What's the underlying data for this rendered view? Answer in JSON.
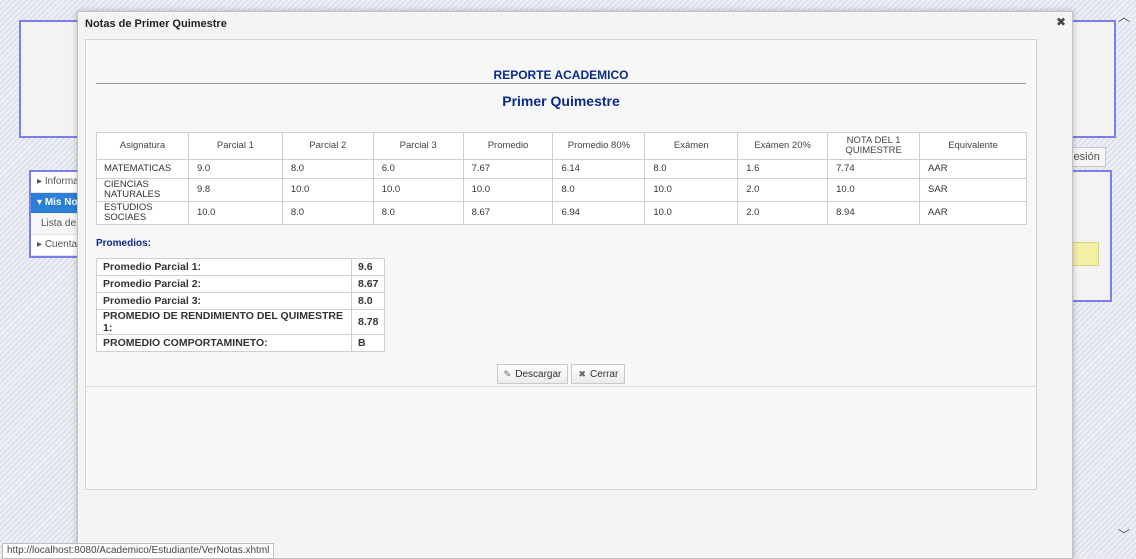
{
  "dialog": {
    "title": "Notas de Primer Quimestre",
    "close_icon": "close-icon"
  },
  "report": {
    "title": "REPORTE ACADEMICO",
    "subtitle": "Primer Quimestre",
    "columns": [
      "Asignatura",
      "Parcial 1",
      "Parcial 2",
      "Parcial 3",
      "Promedio",
      "Promedio 80%",
      "Exámen",
      "Exámen 20%",
      "NOTA DEL 1 QUIMESTRE",
      "Equivalente"
    ],
    "rows": [
      [
        "MATEMATICAS",
        "9.0",
        "8.0",
        "6.0",
        "7.67",
        "6.14",
        "8.0",
        "1.6",
        "7.74",
        "AAR"
      ],
      [
        "CIENCIAS NATURALES",
        "9.8",
        "10.0",
        "10.0",
        "10.0",
        "8.0",
        "10.0",
        "2.0",
        "10.0",
        "SAR"
      ],
      [
        "ESTUDIOS SOCIAES",
        "10.0",
        "8.0",
        "8.0",
        "8.67",
        "6.94",
        "10.0",
        "2.0",
        "8.94",
        "AAR"
      ]
    ],
    "promedios_label": "Promedios:",
    "averages": [
      {
        "label": "Promedio Parcial 1:",
        "value": "9.6"
      },
      {
        "label": "Promedio Parcial 2:",
        "value": "8.67"
      },
      {
        "label": "Promedio Parcial 3:",
        "value": "8.0"
      },
      {
        "label": "PROMEDIO DE RENDIMIENTO DEL QUIMESTRE 1:",
        "value": "8.78"
      },
      {
        "label": "PROMEDIO COMPORTAMINETO:",
        "value": "B"
      }
    ]
  },
  "buttons": {
    "download": "Descargar",
    "close": "Cerrar"
  },
  "background": {
    "sidebar": [
      "Informa",
      "Mis Not",
      "Lista de",
      "Cuenta"
    ],
    "session_button": "Sesión"
  },
  "status_url": "http://localhost:8080/Academico/Estudiante/VerNotas.xhtml"
}
